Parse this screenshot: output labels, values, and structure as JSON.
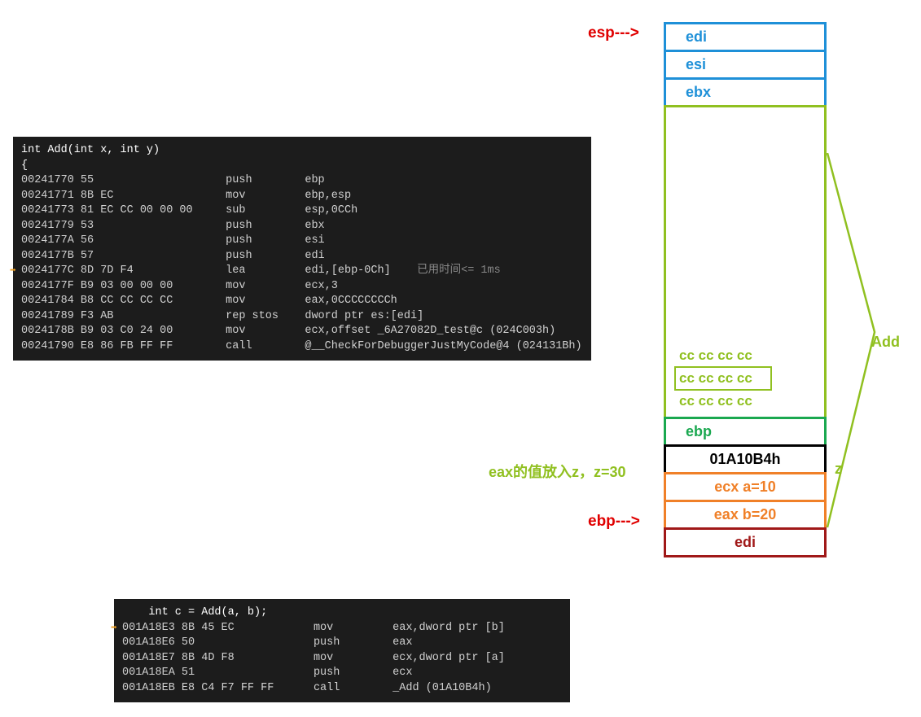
{
  "disasm1": {
    "header": "int Add(int x, int y)",
    "brace": "{",
    "rows": [
      {
        "addr": "00241770",
        "bytes": "55            ",
        "mn": "push    ",
        "ops": "ebp"
      },
      {
        "addr": "00241771",
        "bytes": "8B EC         ",
        "mn": "mov     ",
        "ops": "ebp,esp"
      },
      {
        "addr": "00241773",
        "bytes": "81 EC CC 00 00 00",
        "mn": "sub     ",
        "ops": "esp,0CCh"
      },
      {
        "addr": "00241779",
        "bytes": "53            ",
        "mn": "push    ",
        "ops": "ebx"
      },
      {
        "addr": "0024177A",
        "bytes": "56            ",
        "mn": "push    ",
        "ops": "esi"
      },
      {
        "addr": "0024177B",
        "bytes": "57            ",
        "mn": "push    ",
        "ops": "edi"
      },
      {
        "addr": "0024177C",
        "bytes": "8D 7D F4      ",
        "mn": "lea     ",
        "ops": "edi,[ebp-0Ch]",
        "timing": "已用时间<= 1ms",
        "hl": true
      },
      {
        "addr": "0024177F",
        "bytes": "B9 03 00 00 00",
        "mn": "mov     ",
        "ops": "ecx,3"
      },
      {
        "addr": "00241784",
        "bytes": "B8 CC CC CC CC",
        "mn": "mov     ",
        "ops": "eax,0CCCCCCCCh"
      },
      {
        "addr": "00241789",
        "bytes": "F3 AB         ",
        "mn": "rep stos",
        "ops": "dword ptr es:[edi]"
      },
      {
        "addr": "0024178B",
        "bytes": "B9 03 C0 24 00",
        "mn": "mov     ",
        "ops": "ecx,offset _6A27082D_test@c (024C003h)"
      },
      {
        "addr": "00241790",
        "bytes": "E8 86 FB FF FF",
        "mn": "call    ",
        "ops": "@__CheckForDebuggerJustMyCode@4 (024131Bh)"
      }
    ]
  },
  "disasm2": {
    "header": "    int c = Add(a, b);",
    "rows": [
      {
        "addr": "001A18E3",
        "bytes": "8B 45 EC      ",
        "mn": "mov     ",
        "ops": "eax,dword ptr [b]",
        "hl": true
      },
      {
        "addr": "001A18E6",
        "bytes": "50            ",
        "mn": "push    ",
        "ops": "eax"
      },
      {
        "addr": "001A18E7",
        "bytes": "8B 4D F8      ",
        "mn": "mov     ",
        "ops": "ecx,dword ptr [a]"
      },
      {
        "addr": "001A18EA",
        "bytes": "51            ",
        "mn": "push    ",
        "ops": "ecx"
      },
      {
        "addr": "001A18EB",
        "bytes": "E8 C4 F7 FF FF",
        "mn": "call    ",
        "ops": "_Add (01A10B4h)"
      }
    ]
  },
  "stack": {
    "esp_label": "esp--->",
    "ebp_label": "ebp--->",
    "cells": [
      {
        "text": "edi",
        "color": "#1e90d8"
      },
      {
        "text": "esi",
        "color": "#1e90d8"
      },
      {
        "text": "ebx",
        "color": "#1e90d8"
      }
    ],
    "add_frame_label": "Add",
    "cc_lines": [
      "cc cc cc cc",
      "cc cc cc cc",
      "cc cc cc cc"
    ],
    "z_label": "z",
    "z_note": "eax的值放入z，z=30",
    "below": [
      {
        "text": "ebp",
        "color": "#1aa850",
        "ctr": false
      },
      {
        "text": "01A10B4h",
        "color": "#000",
        "ctr": true
      },
      {
        "text": "ecx  a=10",
        "color": "#f08028",
        "ctr": true
      },
      {
        "text": "eax  b=20",
        "color": "#f08028",
        "ctr": true
      },
      {
        "text": "edi",
        "color": "#a01818",
        "ctr": true
      }
    ]
  }
}
